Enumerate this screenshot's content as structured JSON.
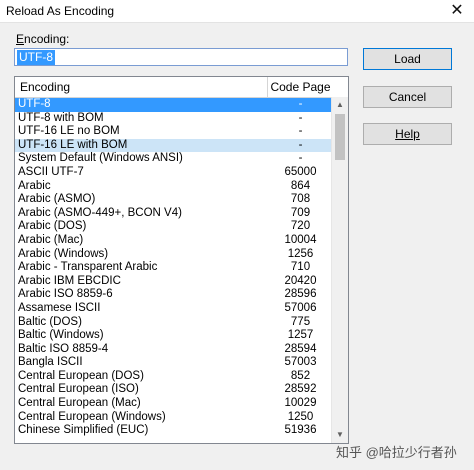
{
  "window": {
    "title": "Reload As Encoding",
    "close_glyph": "✕"
  },
  "encoding_field": {
    "label_prefix": "E",
    "label_rest": "ncoding:",
    "value": "UTF-8"
  },
  "list": {
    "headers": {
      "encoding": "Encoding",
      "code_page": "Code Page"
    },
    "rows": [
      {
        "name": "UTF-8",
        "code": "-"
      },
      {
        "name": "UTF-8 with BOM",
        "code": "-"
      },
      {
        "name": "UTF-16 LE no BOM",
        "code": "-"
      },
      {
        "name": "UTF-16 LE with BOM",
        "code": "-"
      },
      {
        "name": "System Default (Windows ANSI)",
        "code": "-"
      },
      {
        "name": "ASCII UTF-7",
        "code": "65000"
      },
      {
        "name": "Arabic",
        "code": "864"
      },
      {
        "name": "Arabic (ASMO)",
        "code": "708"
      },
      {
        "name": "Arabic (ASMO-449+, BCON V4)",
        "code": "709"
      },
      {
        "name": "Arabic (DOS)",
        "code": "720"
      },
      {
        "name": "Arabic (Mac)",
        "code": "10004"
      },
      {
        "name": "Arabic (Windows)",
        "code": "1256"
      },
      {
        "name": "Arabic - Transparent Arabic",
        "code": "710"
      },
      {
        "name": "Arabic IBM EBCDIC",
        "code": "20420"
      },
      {
        "name": "Arabic ISO 8859-6",
        "code": "28596"
      },
      {
        "name": "Assamese ISCII",
        "code": "57006"
      },
      {
        "name": "Baltic (DOS)",
        "code": "775"
      },
      {
        "name": "Baltic (Windows)",
        "code": "1257"
      },
      {
        "name": "Baltic ISO 8859-4",
        "code": "28594"
      },
      {
        "name": "Bangla ISCII",
        "code": "57003"
      },
      {
        "name": "Central European (DOS)",
        "code": "852"
      },
      {
        "name": "Central European (ISO)",
        "code": "28592"
      },
      {
        "name": "Central European (Mac)",
        "code": "10029"
      },
      {
        "name": "Central European (Windows)",
        "code": "1250"
      },
      {
        "name": "Chinese Simplified (EUC)",
        "code": "51936"
      }
    ],
    "selected_index": 0,
    "hover_index": 3
  },
  "buttons": {
    "load": "Load",
    "cancel": "Cancel",
    "help": "Help"
  },
  "scrollbar": {
    "up_glyph": "▲",
    "down_glyph": "▼"
  },
  "watermark": "知乎 @哈拉少行者孙",
  "colors": {
    "selection": "#3399ff",
    "hover": "#cce4f7",
    "default_button_border": "#0078d7"
  }
}
